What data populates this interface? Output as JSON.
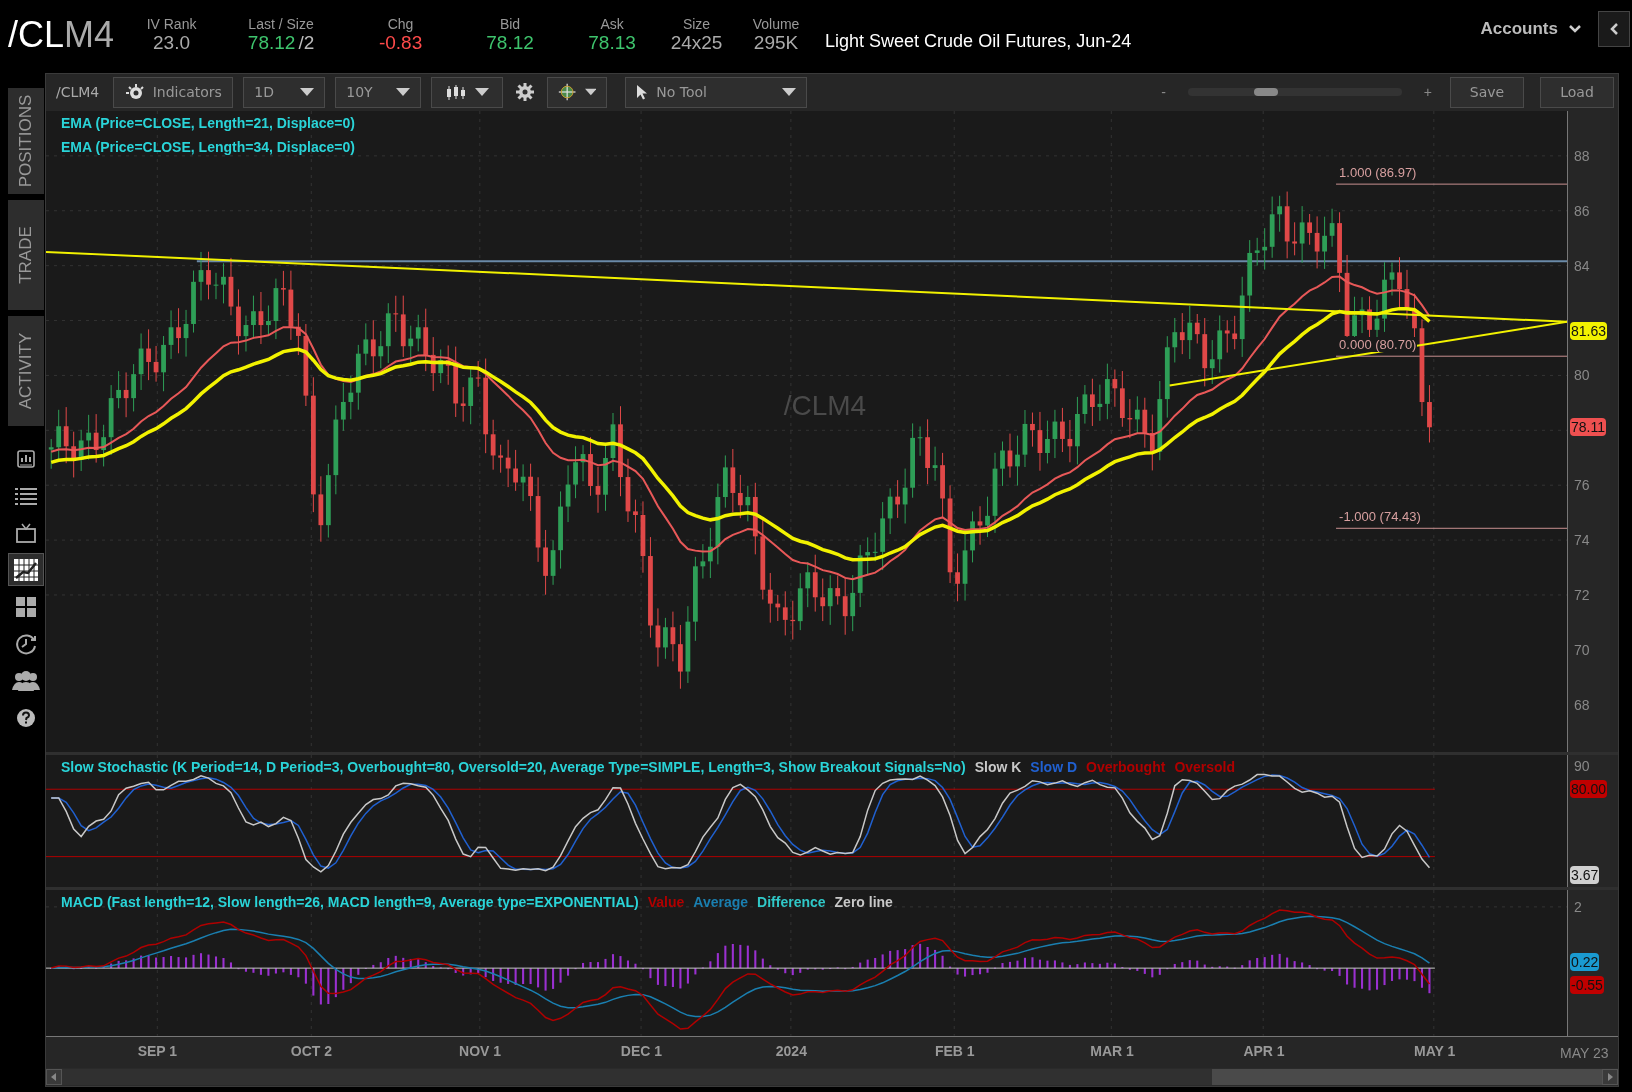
{
  "header": {
    "symbol_root": "/CL",
    "symbol_suffix": "M4",
    "stats": [
      {
        "label": "IV Rank",
        "value": "23.0",
        "color": "#aaaaaa"
      },
      {
        "label": "Last / Size",
        "value": "78.12",
        "extra": "/2",
        "color": "#3ec46d"
      },
      {
        "label": "Chg",
        "value": "-0.83",
        "color": "#ff4a4a"
      },
      {
        "label": "Bid",
        "value": "78.12",
        "color": "#3ec46d"
      },
      {
        "label": "Ask",
        "value": "78.13",
        "color": "#3ec46d"
      },
      {
        "label": "Size",
        "value": "24x25",
        "color": "#aaaaaa"
      },
      {
        "label": "Volume",
        "value": "295K",
        "color": "#aaaaaa"
      }
    ],
    "description": "Light Sweet Crude Oil Futures, Jun-24",
    "accounts_button": "Accounts"
  },
  "sidebar": {
    "tabs": [
      {
        "label": "POSITIONS"
      },
      {
        "label": "TRADE"
      },
      {
        "label": "ACTIVITY"
      }
    ],
    "tools": [
      {
        "kind": "report",
        "selected": false
      },
      {
        "kind": "list",
        "selected": false
      },
      {
        "kind": "tv",
        "selected": false
      },
      {
        "kind": "chart",
        "selected": true
      },
      {
        "kind": "grid",
        "selected": false
      },
      {
        "kind": "clock",
        "selected": false
      },
      {
        "kind": "people",
        "selected": false
      },
      {
        "kind": "help",
        "selected": false
      }
    ]
  },
  "toolbar": {
    "symbol": "/CLM4",
    "indicators_button": "Indicators",
    "aggregation": "1D",
    "timeframe": "10Y",
    "drawing_tool": "No Tool",
    "zoom_out": "-",
    "zoom_slider": {
      "level": 0.35
    },
    "zoom_in": "+",
    "save_button": "Save",
    "load_button": "Load"
  },
  "price_chart": {
    "studies": [
      "EMA (Price=CLOSE, Length=21, Displace=0)",
      "EMA (Price=CLOSE, Length=34, Displace=0)"
    ],
    "watermark": "/CLM4",
    "fib_levels": [
      "1.000 (86.97)",
      "0.000 (80.70)",
      "-1.000 (74.43)"
    ],
    "y_ticks": [
      "88",
      "86",
      "84",
      "80",
      "76",
      "74",
      "72",
      "70",
      "68"
    ],
    "price_badges": [
      {
        "label": "81.63",
        "kind": "trendline"
      },
      {
        "label": "78.11",
        "kind": "last"
      }
    ]
  },
  "stochastic": {
    "title": "Slow Stochastic (K Period=14, D Period=3, Overbought=80, Oversold=20, Average Type=SIMPLE, Length=3, Show Breakout Signals=No)",
    "legend": [
      {
        "label": "Slow K",
        "color": "#c8c8c8"
      },
      {
        "label": "Slow D",
        "color": "#2060d0"
      },
      {
        "label": "Overbought",
        "color": "#b00000"
      },
      {
        "label": "Oversold",
        "color": "#b00000"
      }
    ],
    "y_ticks": [
      "90"
    ],
    "badges": [
      {
        "label": "80.00",
        "color": "#c00000"
      },
      {
        "label": "3.67",
        "color": "#d0d0d0"
      }
    ]
  },
  "macd": {
    "title": "MACD (Fast length=12, Slow length=26, MACD length=9, Average type=EXPONENTIAL)",
    "legend": [
      {
        "label": "Value",
        "color": "#b00000"
      },
      {
        "label": "Average",
        "color": "#1a7fb0"
      },
      {
        "label": "Difference",
        "color": "#30c8c8"
      },
      {
        "label": "Zero line",
        "color": "#c8c8c8"
      }
    ],
    "y_ticks": [
      "2"
    ],
    "badges": [
      {
        "label": "0.22",
        "color": "#1a9ad0"
      },
      {
        "label": "-0.55",
        "color": "#c00000"
      }
    ]
  },
  "time_axis": {
    "labels": [
      "SEP 1",
      "OCT 2",
      "NOV 1",
      "DEC 1",
      "2024",
      "FEB 1",
      "MAR 1",
      "APR 1",
      "MAY 1"
    ],
    "end_label": "MAY 23"
  }
}
